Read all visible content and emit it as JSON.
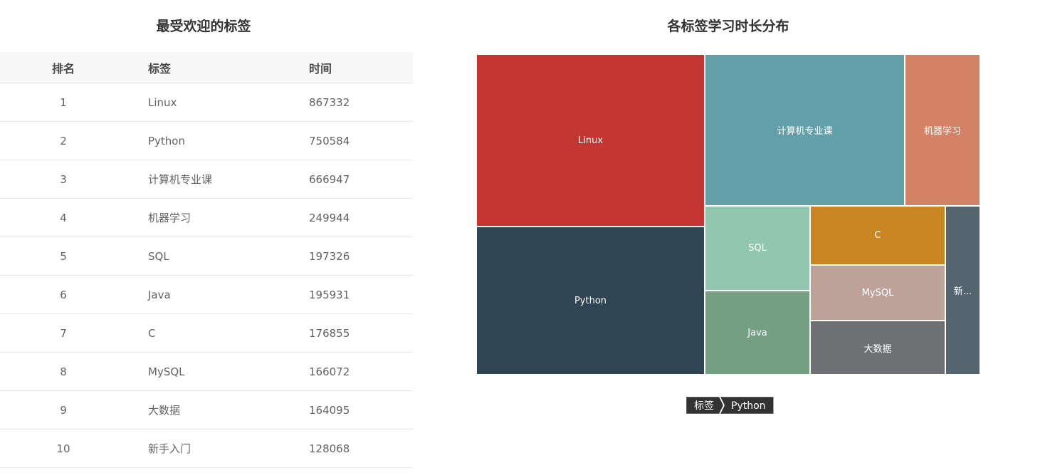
{
  "left_title": "最受欢迎的标签",
  "right_title": "各标签学习时长分布",
  "table": {
    "headers": {
      "rank": "排名",
      "tag": "标签",
      "time": "时间"
    },
    "rows": [
      {
        "rank": "1",
        "tag": "Linux",
        "time": "867332"
      },
      {
        "rank": "2",
        "tag": "Python",
        "time": "750584"
      },
      {
        "rank": "3",
        "tag": "计算机专业课",
        "time": "666947"
      },
      {
        "rank": "4",
        "tag": "机器学习",
        "time": "249944"
      },
      {
        "rank": "5",
        "tag": "SQL",
        "time": "197326"
      },
      {
        "rank": "6",
        "tag": "Java",
        "time": "195931"
      },
      {
        "rank": "7",
        "tag": "C",
        "time": "176855"
      },
      {
        "rank": "8",
        "tag": "MySQL",
        "time": "166072"
      },
      {
        "rank": "9",
        "tag": "大数据",
        "time": "164095"
      },
      {
        "rank": "10",
        "tag": "新手入门",
        "time": "128068"
      }
    ]
  },
  "treemap": {
    "tiles": [
      {
        "label": "Linux",
        "color": "#c23531"
      },
      {
        "label": "Python",
        "color": "#2f4554"
      },
      {
        "label": "计算机专业课",
        "color": "#61a0a8"
      },
      {
        "label": "机器学习",
        "color": "#d48265"
      },
      {
        "label": "SQL",
        "color": "#91c7ae"
      },
      {
        "label": "Java",
        "color": "#749f83"
      },
      {
        "label": "C",
        "color": "#ca8622"
      },
      {
        "label": "MySQL",
        "color": "#bda29a"
      },
      {
        "label": "大数据",
        "color": "#6e7074"
      },
      {
        "label": "新...",
        "color": "#546570"
      }
    ]
  },
  "breadcrumb": {
    "items": [
      "标签",
      "Python"
    ]
  }
}
